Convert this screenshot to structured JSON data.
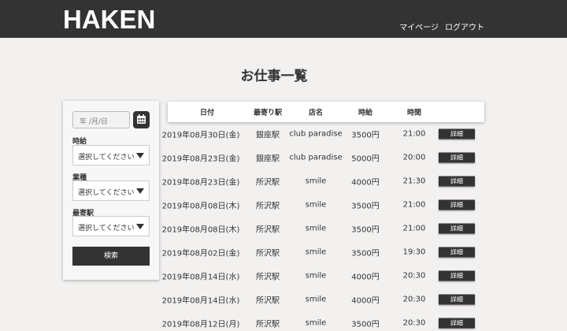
{
  "header": {
    "logo": "HAKEN",
    "nav": [
      "マイページ",
      "ログアウト"
    ]
  },
  "page_title": "お仕事一覧",
  "search": {
    "date_placeholder": "年 /月/日",
    "wage_label": "時給",
    "industry_label": "業種",
    "station_label": "最寄駅",
    "select_placeholder": "選択してください",
    "search_button": "検索"
  },
  "table": {
    "headers": [
      "日付",
      "最寄り駅",
      "店名",
      "時給",
      "時間"
    ],
    "detail_label": "詳細",
    "rows": [
      [
        "2019年08月30日(金)",
        "銀座駅",
        "club paradise",
        "3500円",
        "21:00"
      ],
      [
        "2019年08月23日(金)",
        "銀座駅",
        "club paradise",
        "5000円",
        "20:00"
      ],
      [
        "2019年08月23日(金)",
        "所沢駅",
        "smile",
        "4000円",
        "21:30"
      ],
      [
        "2019年08月08日(木)",
        "所沢駅",
        "smile",
        "3500円",
        "21:00"
      ],
      [
        "2019年08月08日(木)",
        "所沢駅",
        "smile",
        "3500円",
        "21:00"
      ],
      [
        "2019年08月02日(金)",
        "所沢駅",
        "smile",
        "3500円",
        "19:30"
      ],
      [
        "2019年08月14日(水)",
        "所沢駅",
        "smile",
        "4000円",
        "20:30"
      ],
      [
        "2019年08月14日(水)",
        "所沢駅",
        "smile",
        "4000円",
        "20:30"
      ],
      [
        "2019年08月12日(月)",
        "所沢駅",
        "smile",
        "3500円",
        "20:30"
      ]
    ]
  }
}
